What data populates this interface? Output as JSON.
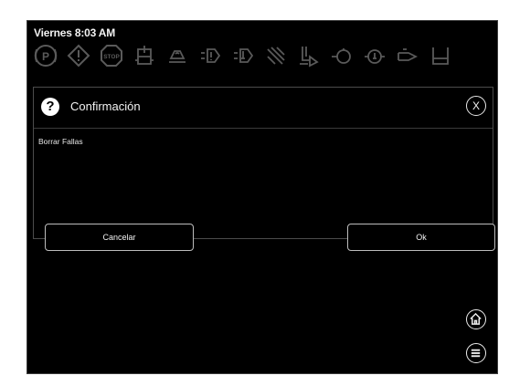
{
  "status_bar": {
    "time": "Viernes 8:03 AM"
  },
  "indicators": [
    {
      "name": "parking-brake-icon"
    },
    {
      "name": "warning-icon"
    },
    {
      "name": "stop-icon",
      "text": "STOP"
    },
    {
      "name": "coolant-level-icon"
    },
    {
      "name": "hydraulic-oil-icon"
    },
    {
      "name": "transmission-icon"
    },
    {
      "name": "transmission-temp-icon"
    },
    {
      "name": "hydraulic-filter-icon"
    },
    {
      "name": "fuel-filter-icon"
    },
    {
      "name": "engine-oil-pressure-icon"
    },
    {
      "name": "engine-temperature-icon"
    },
    {
      "name": "water-in-fuel-icon"
    },
    {
      "name": "fuel-level-icon"
    }
  ],
  "dialog": {
    "title": "Confirmación",
    "close_label": "X",
    "message": "Borrar Fallas",
    "cancel_label": "Cancelar",
    "ok_label": "Ok"
  },
  "colors": {
    "background": "#000000",
    "text": "#f2f2f2",
    "icon_inactive": "#5a5a5a",
    "border": "#bdbdbd"
  }
}
